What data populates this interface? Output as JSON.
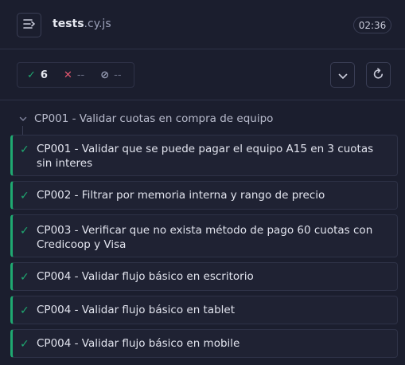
{
  "header": {
    "file_base": "tests",
    "file_ext": ".cy.js",
    "timer": "02:36"
  },
  "stats": {
    "passed_icon": "✓",
    "passed": "6",
    "failed_icon": "✕",
    "failed": "--",
    "pending_icon": "⊘",
    "pending": "--"
  },
  "suite": {
    "title": "CP001 - Validar cuotas en compra de equipo"
  },
  "tests": [
    {
      "title": "CP001 - Validar que se puede pagar el equipo A15 en 3 cuotas sin interes",
      "state": "passed"
    },
    {
      "title": "CP002 - Filtrar por memoria interna y rango de precio",
      "state": "passed"
    },
    {
      "title": "CP003 - Verificar que no exista método de pago 60 cuotas con Credicoop y Visa",
      "state": "passed"
    },
    {
      "title": "CP004 - Validar flujo básico en escritorio",
      "state": "passed"
    },
    {
      "title": "CP004 - Validar flujo básico en tablet",
      "state": "passed"
    },
    {
      "title": "CP004 - Validar flujo básico en mobile",
      "state": "passed"
    }
  ],
  "colors": {
    "background": "#1b1e2e",
    "passed": "#1fa971",
    "failed": "#e45770",
    "border": "#2e3247"
  }
}
